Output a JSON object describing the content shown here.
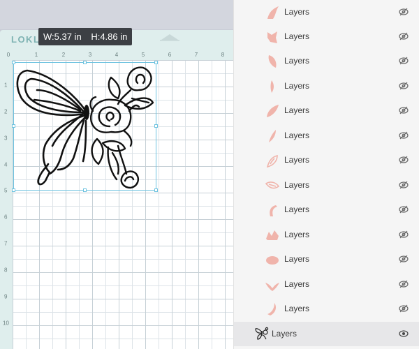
{
  "canvas": {
    "logo": "LOKLI",
    "tooltip": {
      "width": "W:5.37 in",
      "height": "H:4.86 in"
    },
    "ruler": {
      "horizontal": [
        "0",
        "1",
        "2",
        "3",
        "4",
        "5",
        "6",
        "7",
        "8"
      ],
      "vertical": [
        "1",
        "2",
        "3",
        "4",
        "5",
        "6",
        "7",
        "8",
        "9",
        "10"
      ]
    }
  },
  "layers": {
    "items": [
      {
        "label": "Layers",
        "thumb": "petal-curl-icon",
        "hidden": true
      },
      {
        "label": "Layers",
        "thumb": "leaf-notched-icon",
        "hidden": true
      },
      {
        "label": "Layers",
        "thumb": "leaf-curve-icon",
        "hidden": true
      },
      {
        "label": "Layers",
        "thumb": "leaf-thin-icon",
        "hidden": true
      },
      {
        "label": "Layers",
        "thumb": "petal-tip-icon",
        "hidden": true
      },
      {
        "label": "Layers",
        "thumb": "leaf-slim-icon",
        "hidden": true
      },
      {
        "label": "Layers",
        "thumb": "outline-leaf-icon",
        "hidden": true
      },
      {
        "label": "Layers",
        "thumb": "outline-petal-icon",
        "hidden": true
      },
      {
        "label": "Layers",
        "thumb": "hook-icon",
        "hidden": true
      },
      {
        "label": "Layers",
        "thumb": "crown-icon",
        "hidden": true
      },
      {
        "label": "Layers",
        "thumb": "oval-petal-icon",
        "hidden": true
      },
      {
        "label": "Layers",
        "thumb": "wing-petal-icon",
        "hidden": true
      },
      {
        "label": "Layers",
        "thumb": "sliver-icon",
        "hidden": true
      }
    ],
    "group": {
      "label": "Layers",
      "thumb": "butterfly-thumb-icon",
      "hidden": false,
      "selected": true
    }
  },
  "colors": {
    "thumb_fill": "#f0b4ab",
    "selection": "#6ec3e0",
    "mat": "#dfeeed"
  }
}
